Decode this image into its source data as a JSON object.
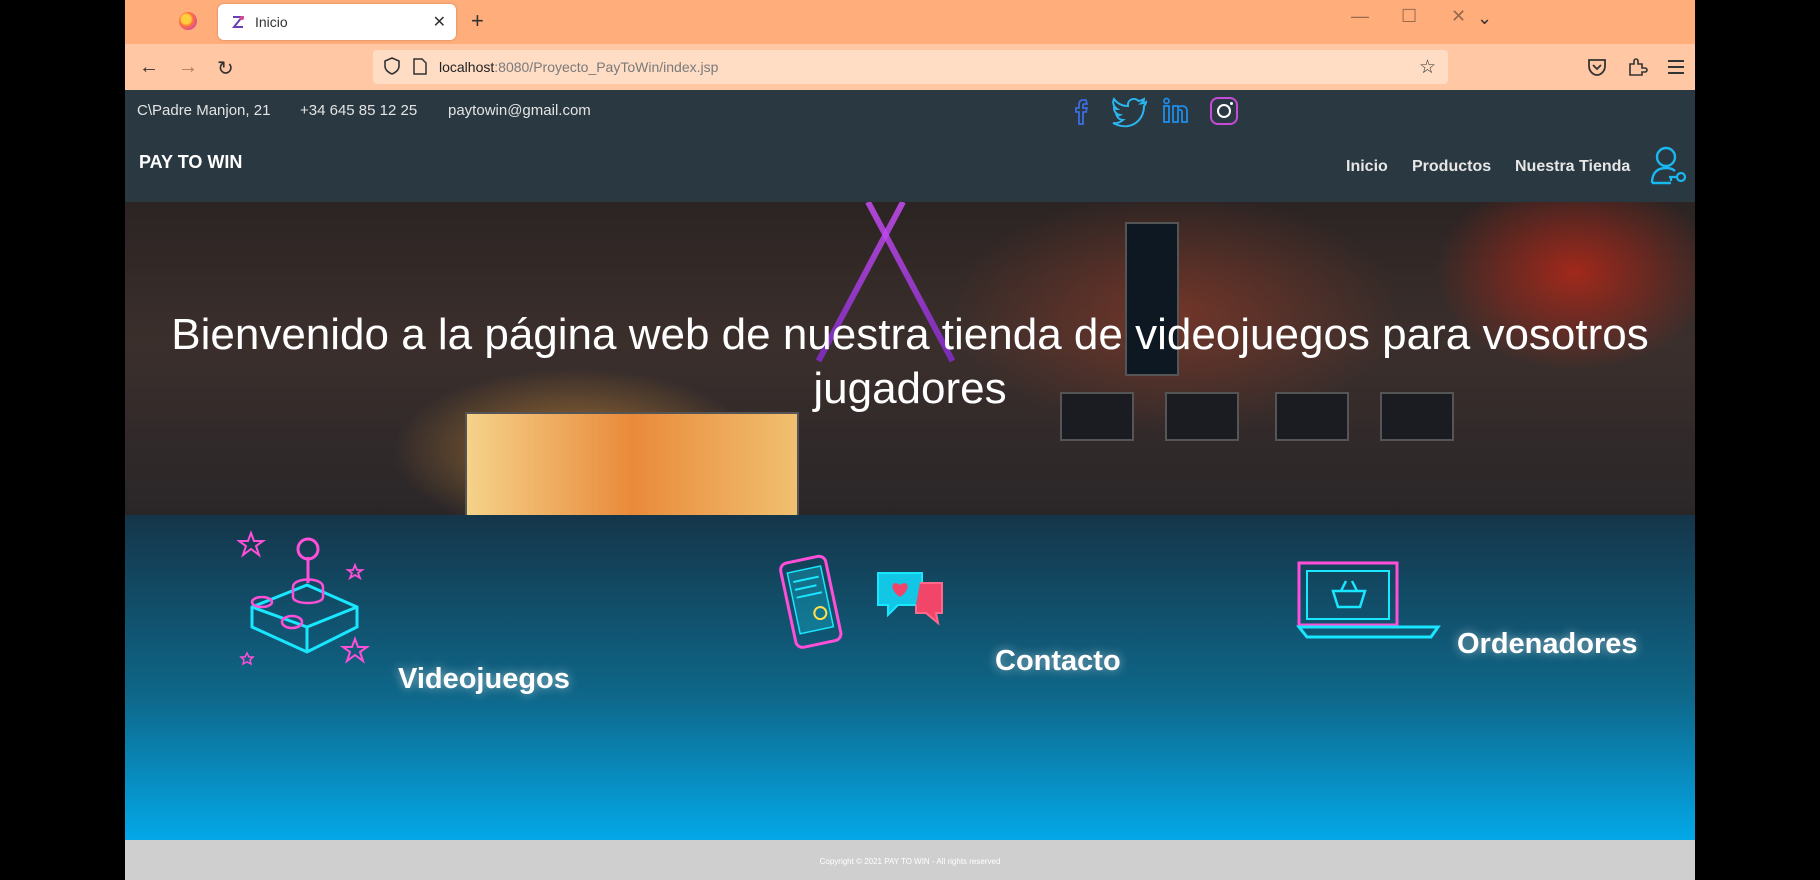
{
  "browser": {
    "tab_title": "Inicio",
    "url_host": "localhost",
    "url_path": ":8080/Proyecto_PayToWin/index.jsp"
  },
  "site": {
    "address": "C\\Padre Manjon, 21",
    "phone": "+34 645 85 12 25",
    "email": "paytowin@gmail.com",
    "brand": "PAY TO WIN",
    "menu": [
      "Inicio",
      "Productos",
      "Nuestra Tienda"
    ],
    "social": [
      "facebook-icon",
      "twitter-icon",
      "linkedin-icon",
      "instagram-icon"
    ],
    "hero_title": "Bienvenido a la página web de nuestra tienda de videojuegos para vosotros jugadores",
    "features": [
      "Videojuegos",
      "Contacto",
      "Ordenadores"
    ],
    "footer": "Copyright © 2021 PAY TO WIN - All rights reserved"
  },
  "colors": {
    "tabstrip": "#ffad7a",
    "navbar": "#ffc7a3",
    "topbar": "#2a3841",
    "neon_pink": "#ff4fd8",
    "neon_cyan": "#19e6ff",
    "features_gradient_end": "#04a8e8"
  }
}
